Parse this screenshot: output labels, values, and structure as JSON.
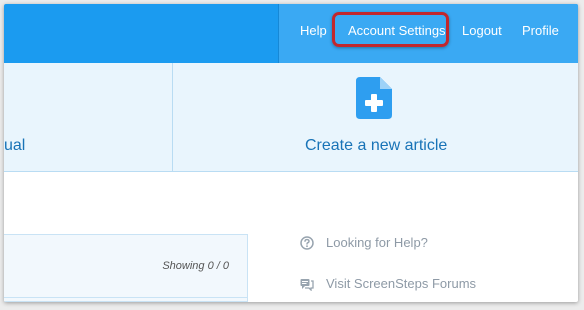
{
  "nav": {
    "help": "Help",
    "account_settings": "Account Settings",
    "logout": "Logout",
    "profile": "Profile"
  },
  "tiles": {
    "left_partial": "ual",
    "create_article": "Create a new article"
  },
  "panel": {
    "showing": "Showing 0 / 0"
  },
  "sidebar": {
    "looking_for_help": "Looking for Help?",
    "visit_forums": "Visit ScreenSteps Forums"
  },
  "colors": {
    "topbar": "#1b9bf0",
    "nav": "#3aa9f3",
    "highlight": "#c1272d",
    "tile_bg": "#e9f5fd",
    "link": "#1873b7"
  },
  "icons": {
    "create_article": "new-document-icon",
    "help": "question-circle-icon",
    "forums": "chat-bubbles-icon"
  }
}
